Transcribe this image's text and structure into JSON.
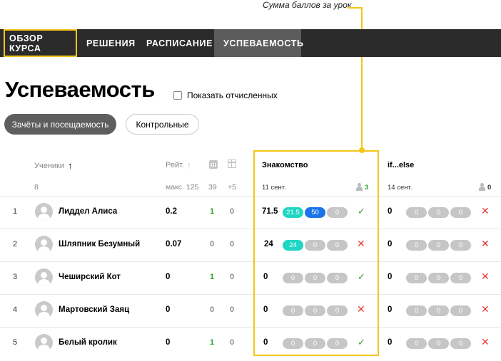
{
  "callout": "Сумма баллов за урок",
  "nav": [
    "ОБЗОР КУРСА",
    "РЕШЕНИЯ",
    "РАСПИСАНИЕ",
    "УСПЕВАЕМОСТЬ"
  ],
  "page_title": "Успеваемость",
  "show_expelled": "Показать отчисленных",
  "buttons": {
    "attendance": "Зачёты и посещаемость",
    "tests": "Контрольные"
  },
  "columns": {
    "students": "Ученики",
    "sort_arrow": "↑",
    "rating": "Рейт.",
    "rating_arrow": "↑",
    "lesson1": "Знакомство",
    "lesson2": "if...else"
  },
  "summary": {
    "student_count": "8",
    "max": "макс. 125",
    "total1": "39",
    "total2": "+5",
    "lesson1_date": "11 сент.",
    "lesson1_count": "3",
    "lesson2_date": "14 сент.",
    "lesson2_count": "0"
  },
  "rows": [
    {
      "num": "1",
      "name": "Лиддел Алиса",
      "rating": "0.2",
      "c1": "1",
      "c2": "0",
      "l1_total": "71.5",
      "l1_pills": [
        "21.5",
        "50",
        "0"
      ],
      "l1_ok": true,
      "l2_total": "0",
      "l2_pills": [
        "0",
        "0",
        "0"
      ],
      "l2_ok": false
    },
    {
      "num": "2",
      "name": "Шляпник Безумный",
      "rating": "0.07",
      "c1": "0",
      "c2": "0",
      "l1_total": "24",
      "l1_pills": [
        "24",
        "0",
        "0"
      ],
      "l1_ok": false,
      "l2_total": "0",
      "l2_pills": [
        "0",
        "0",
        "0"
      ],
      "l2_ok": false
    },
    {
      "num": "3",
      "name": "Чеширский Кот",
      "rating": "0",
      "c1": "1",
      "c2": "0",
      "l1_total": "0",
      "l1_pills": [
        "0",
        "0",
        "0"
      ],
      "l1_ok": true,
      "l2_total": "0",
      "l2_pills": [
        "0",
        "0",
        "0"
      ],
      "l2_ok": false
    },
    {
      "num": "4",
      "name": "Мартовский Заяц",
      "rating": "0",
      "c1": "0",
      "c2": "0",
      "l1_total": "0",
      "l1_pills": [
        "0",
        "0",
        "0"
      ],
      "l1_ok": false,
      "l2_total": "0",
      "l2_pills": [
        "0",
        "0",
        "0"
      ],
      "l2_ok": false
    },
    {
      "num": "5",
      "name": "Белый кролик",
      "rating": "0",
      "c1": "1",
      "c2": "0",
      "l1_total": "0",
      "l1_pills": [
        "0",
        "0",
        "0"
      ],
      "l1_ok": true,
      "l2_total": "0",
      "l2_pills": [
        "0",
        "0",
        "0"
      ],
      "l2_ok": false
    }
  ],
  "colors": {
    "highlight": "#f5c518",
    "teal": "#1fd6c3",
    "blue": "#1c75e8",
    "ok": "#2aa12a",
    "no": "#e53935"
  }
}
